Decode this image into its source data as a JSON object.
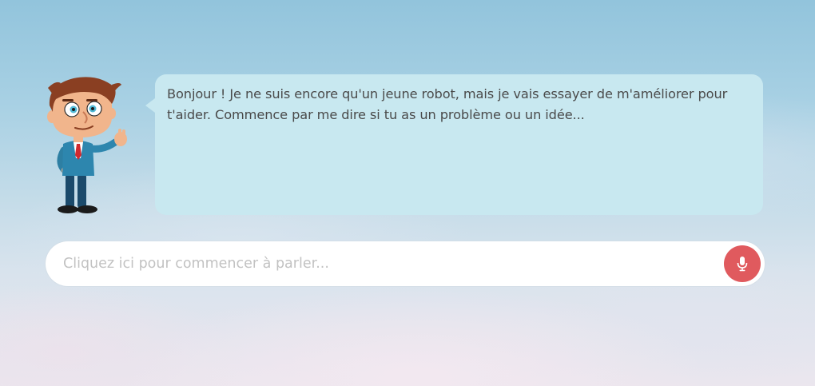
{
  "chat": {
    "avatar_icon": "cartoon-boy-waving-icon",
    "message": "Bonjour ! Je ne suis encore qu'un jeune robot, mais je vais essayer de m'améliorer pour t'aider. Commence par me dire si tu as un problème ou un idée..."
  },
  "input": {
    "placeholder": "Cliquez ici pour commencer à parler...",
    "value": ""
  },
  "mic_button": {
    "icon": "microphone-icon",
    "color": "#e05a5e"
  },
  "colors": {
    "bubble": "#c8e8f0",
    "text": "#4a4a4a"
  }
}
